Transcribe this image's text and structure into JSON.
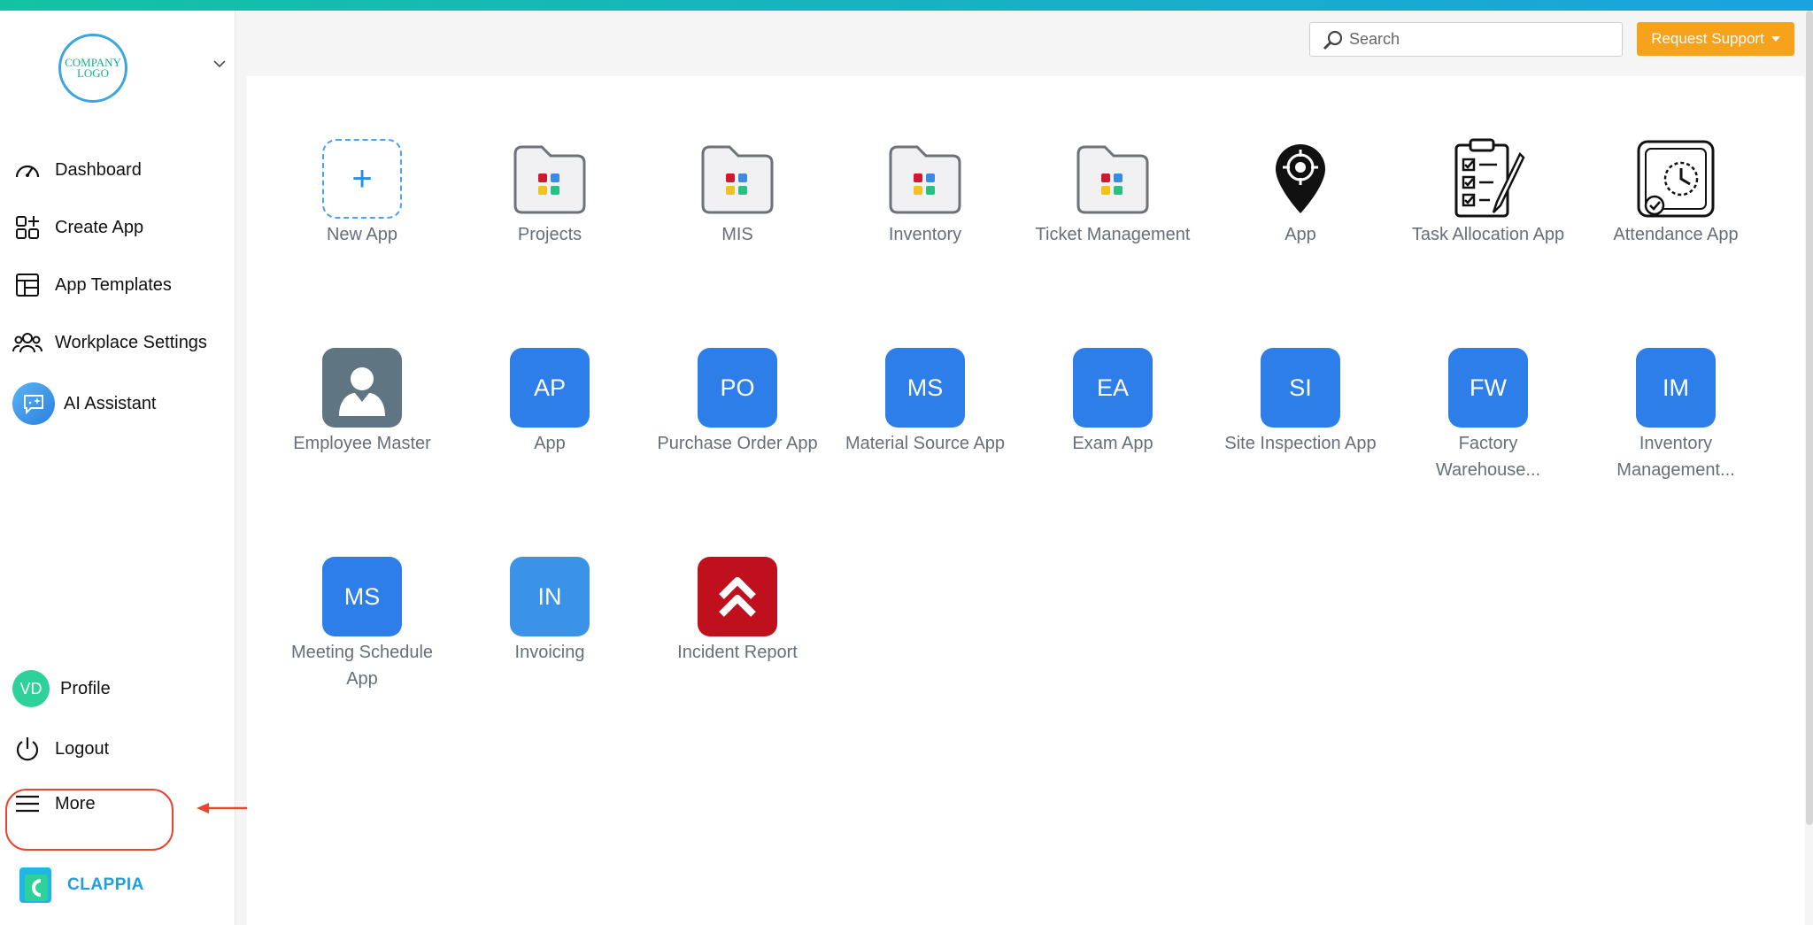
{
  "sidebar": {
    "logo_text": "COMPANY LOGO",
    "nav": [
      {
        "label": "Dashboard",
        "icon": "speedometer-icon"
      },
      {
        "label": "Create App",
        "icon": "add-grid-icon"
      },
      {
        "label": "App Templates",
        "icon": "template-icon"
      },
      {
        "label": "Workplace Settings",
        "icon": "people-icon"
      },
      {
        "label": "AI Assistant",
        "icon": "ai-chat-icon"
      }
    ],
    "profile": {
      "initials": "VD",
      "label": "Profile"
    },
    "logout_label": "Logout",
    "more_label": "More",
    "brand_name": "CLAPPIA"
  },
  "header": {
    "search_placeholder": "Search",
    "support_label": "Request Support"
  },
  "apps": [
    {
      "label": "New App",
      "kind": "new"
    },
    {
      "label": "Projects",
      "kind": "folder"
    },
    {
      "label": "MIS",
      "kind": "folder"
    },
    {
      "label": "Inventory",
      "kind": "folder"
    },
    {
      "label": "Ticket Management",
      "kind": "folder"
    },
    {
      "label": "App",
      "kind": "location-pin-icon"
    },
    {
      "label": "Task Allocation App",
      "kind": "clipboard-checklist-icon"
    },
    {
      "label": "Attendance App",
      "kind": "attendance-clock-icon"
    },
    {
      "label": "Employee Master",
      "kind": "person-icon"
    },
    {
      "label": "App",
      "kind": "initials",
      "initials": "AP"
    },
    {
      "label": "Purchase Order App",
      "kind": "initials",
      "initials": "PO"
    },
    {
      "label": "Material Source App",
      "kind": "initials",
      "initials": "MS"
    },
    {
      "label": "Exam App",
      "kind": "initials",
      "initials": "EA"
    },
    {
      "label": "Site Inspection App",
      "kind": "initials",
      "initials": "SI"
    },
    {
      "label": "Factory Warehouse...",
      "kind": "initials",
      "initials": "FW"
    },
    {
      "label": "Inventory Management...",
      "kind": "initials",
      "initials": "IM"
    },
    {
      "label": "Meeting Schedule App",
      "kind": "initials",
      "initials": "MS"
    },
    {
      "label": "Invoicing",
      "kind": "initials",
      "initials": "IN"
    },
    {
      "label": "Incident Report",
      "kind": "incident-chevrons-icon"
    }
  ],
  "colors": {
    "accent_blue": "#2d7ee8",
    "support_orange": "#f7a21b",
    "highlight_red": "#e8452f",
    "incident_red": "#c0101e"
  }
}
